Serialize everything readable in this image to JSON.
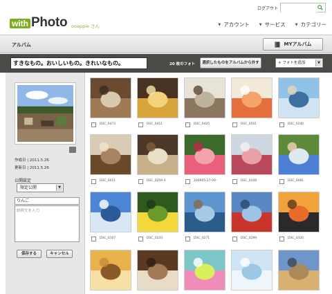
{
  "header": {
    "login_label": "ログアウト",
    "search_placeholder": "",
    "logo_with": "with",
    "logo_photo": "Photo",
    "user_label": "ooapple さん",
    "nav": [
      {
        "label": "アカウント"
      },
      {
        "label": "サービス"
      },
      {
        "label": "カテゴリー"
      }
    ]
  },
  "album_bar": {
    "title": "アルバム",
    "my_album_label": "MYアルバム"
  },
  "title_band": {
    "album_name": "すきなもの。おいしいもの。きれいなもの。",
    "photo_count": "20 枚のフォト",
    "move_button_label": "選択したものをアルバムから外す",
    "add_photo_select": "+ フォトを追加"
  },
  "left_panel": {
    "created": "作成日 | 2011.5.26",
    "updated": "更新日 | 2011.5.26",
    "visibility_label": "公開設定",
    "visibility_value": "限定公開",
    "tag_value": "りんご",
    "description_placeholder": "説明文を入力",
    "save_label": "保存する",
    "cancel_label": "キャンセル"
  },
  "photos": [
    {
      "caption": "DSC_0473"
    },
    {
      "caption": "DSC_0411"
    },
    {
      "caption": "DSC_0425"
    },
    {
      "caption": "DSC_0501"
    },
    {
      "caption": "DSC_0240"
    },
    {
      "caption": "DSC_0011"
    },
    {
      "caption": "DSC_0259-0"
    },
    {
      "caption": "200905-27-09-"
    },
    {
      "caption": "DSC_0108"
    },
    {
      "caption": "DSC_0081"
    },
    {
      "caption": "DSC_0107"
    },
    {
      "caption": "DSC_0234"
    },
    {
      "caption": "DSC_0271"
    },
    {
      "caption": "DSC_0299"
    },
    {
      "caption": "DSC_0320"
    },
    {
      "caption": ""
    },
    {
      "caption": ""
    },
    {
      "caption": ""
    },
    {
      "caption": ""
    },
    {
      "caption": ""
    }
  ],
  "colors": {
    "brand_green": "#7cae1e",
    "title_band": "#4a4a47"
  }
}
